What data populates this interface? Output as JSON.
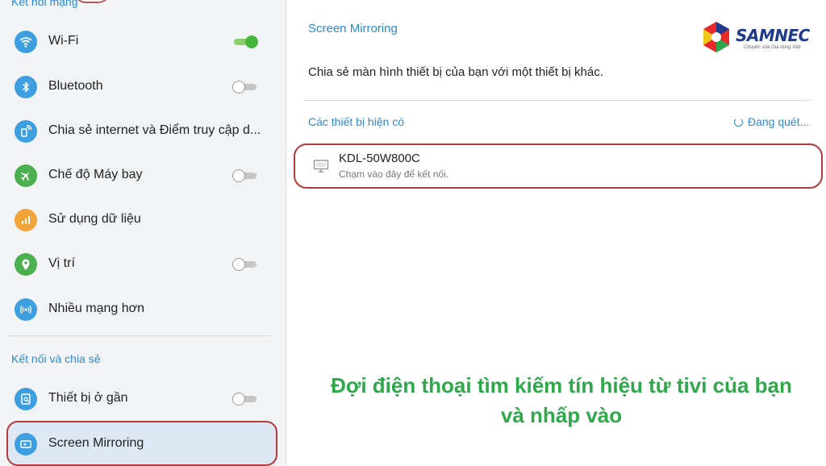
{
  "left_panel": {
    "section_network": "Kết nối mạng",
    "section_share": "Kết nối và chia sẻ",
    "items": [
      {
        "label": "Wi-Fi",
        "icon": "wifi-icon",
        "toggle": "on"
      },
      {
        "label": "Bluetooth",
        "icon": "bluetooth-icon",
        "toggle": "off"
      },
      {
        "label": "Chia sẻ internet và Điểm truy cập d...",
        "icon": "hotspot-icon",
        "toggle": null
      },
      {
        "label": "Chế độ Máy bay",
        "icon": "airplane-icon",
        "toggle": "off"
      },
      {
        "label": "Sử dụng dữ liệu",
        "icon": "data-usage-icon",
        "toggle": null
      },
      {
        "label": "Vị trí",
        "icon": "location-icon",
        "toggle": "off"
      },
      {
        "label": "Nhiều mạng hơn",
        "icon": "more-networks-icon",
        "toggle": null
      },
      {
        "label": "Thiết bị ở gần",
        "icon": "nearby-device-icon",
        "toggle": "off"
      },
      {
        "label": "Screen Mirroring",
        "icon": "screen-mirroring-icon",
        "toggle": null,
        "selected": true
      }
    ]
  },
  "right_panel": {
    "title": "Screen Mirroring",
    "description": "Chia sẻ màn hình thiết bị của bạn với một thiết bị khác.",
    "available_devices": "Các thiết bị hiện có",
    "scanning": "Đang quét...",
    "device": {
      "name": "KDL-50W800C",
      "subtitle": "Chạm vào đây để kết nối."
    }
  },
  "logo": {
    "text": "SAMNEC",
    "tagline": "Chuyên sửa Gia dụng Việt"
  },
  "caption": {
    "line1": "Đợi điện thoại tìm kiếm tín hiệu từ tivi của bạn",
    "line2": "và nhấp vào"
  },
  "colors": {
    "accent": "#2a8ad0",
    "icon_blue": "#3d9fe0",
    "icon_green": "#4caf50",
    "icon_orange": "#f2a33a",
    "toggle_on": "#44b53a",
    "highlight_border": "#b23a3a",
    "caption_green": "#2ea84a"
  }
}
